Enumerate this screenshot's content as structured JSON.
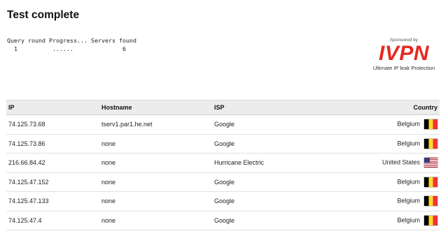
{
  "page": {
    "title": "Test complete"
  },
  "query_table": {
    "headers": [
      "Query round",
      "Progress...",
      "Servers found"
    ],
    "row": {
      "round": "1",
      "progress": "......",
      "servers": "6"
    }
  },
  "sponsor": {
    "label": "Sponsored by",
    "logo_text": "IVPN",
    "tagline": "Ultimate IP leak Protection",
    "brand_color": "#e32a22"
  },
  "results": {
    "headers": {
      "ip": "IP",
      "hostname": "Hostname",
      "isp": "ISP",
      "country": "Country"
    },
    "rows": [
      {
        "ip": "74.125.73.68",
        "hostname": "tserv1.par1.he.net",
        "isp": "Google",
        "country": "Belgium",
        "flag": "belgium-flag-icon"
      },
      {
        "ip": "74.125.73.86",
        "hostname": "none",
        "isp": "Google",
        "country": "Belgium",
        "flag": "belgium-flag-icon"
      },
      {
        "ip": "216.66.84.42",
        "hostname": "none",
        "isp": "Hurricane Electric",
        "country": "United States",
        "flag": "us-flag-icon"
      },
      {
        "ip": "74.125.47.152",
        "hostname": "none",
        "isp": "Google",
        "country": "Belgium",
        "flag": "belgium-flag-icon"
      },
      {
        "ip": "74.125.47.133",
        "hostname": "none",
        "isp": "Google",
        "country": "Belgium",
        "flag": "belgium-flag-icon"
      },
      {
        "ip": "74.125.47.4",
        "hostname": "none",
        "isp": "Google",
        "country": "Belgium",
        "flag": "belgium-flag-icon"
      }
    ]
  }
}
